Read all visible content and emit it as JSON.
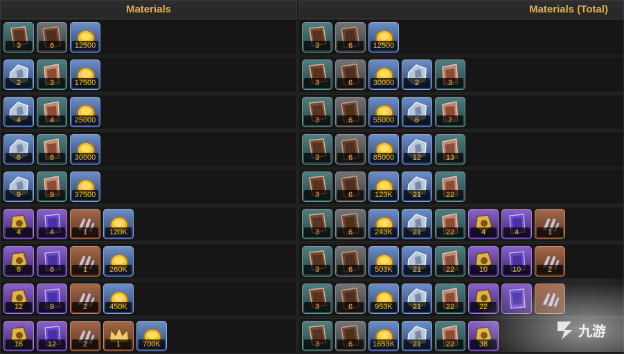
{
  "headers": {
    "left": "Materials",
    "right": "Materials (Total)"
  },
  "left_rows": [
    [
      {
        "icon": "leather-scroll-icon",
        "tier": "teal",
        "qty": "3"
      },
      {
        "icon": "leather-tome-icon",
        "tier": "gray",
        "qty": "6"
      },
      {
        "icon": "gold-coin-icon",
        "tier": "blue",
        "qty": "12500"
      }
    ],
    [
      {
        "icon": "ore-chunk-icon",
        "tier": "blue",
        "qty": "2"
      },
      {
        "icon": "cloth-roll-icon",
        "tier": "teal",
        "qty": "3"
      },
      {
        "icon": "gold-coin-icon",
        "tier": "blue",
        "qty": "17500"
      }
    ],
    [
      {
        "icon": "ore-chunk-icon",
        "tier": "blue",
        "qty": "4"
      },
      {
        "icon": "cloth-roll-icon",
        "tier": "teal",
        "qty": "4"
      },
      {
        "icon": "gold-coin-icon",
        "tier": "blue",
        "qty": "25000"
      }
    ],
    [
      {
        "icon": "ore-chunk-icon",
        "tier": "blue",
        "qty": "6"
      },
      {
        "icon": "cloth-roll-icon",
        "tier": "teal",
        "qty": "6"
      },
      {
        "icon": "gold-coin-icon",
        "tier": "blue",
        "qty": "30000"
      }
    ],
    [
      {
        "icon": "ore-chunk-icon",
        "tier": "blue",
        "qty": "9"
      },
      {
        "icon": "cloth-roll-icon",
        "tier": "teal",
        "qty": "9"
      },
      {
        "icon": "gold-coin-icon",
        "tier": "blue",
        "qty": "37500"
      }
    ],
    [
      {
        "icon": "gold-relic-icon",
        "tier": "purple",
        "qty": "4"
      },
      {
        "icon": "violet-scroll-icon",
        "tier": "purple",
        "qty": "4"
      },
      {
        "icon": "claw-gauntlet-icon",
        "tier": "orange",
        "qty": "1"
      },
      {
        "icon": "gold-coin-icon",
        "tier": "blue",
        "qty": "120K"
      }
    ],
    [
      {
        "icon": "gold-relic-icon",
        "tier": "purple",
        "qty": "6"
      },
      {
        "icon": "violet-scroll-icon",
        "tier": "purple",
        "qty": "6"
      },
      {
        "icon": "claw-gauntlet-icon",
        "tier": "orange",
        "qty": "1"
      },
      {
        "icon": "gold-coin-icon",
        "tier": "blue",
        "qty": "260K"
      }
    ],
    [
      {
        "icon": "gold-relic-icon",
        "tier": "purple",
        "qty": "12"
      },
      {
        "icon": "violet-scroll-icon",
        "tier": "purple",
        "qty": "9"
      },
      {
        "icon": "claw-gauntlet-icon",
        "tier": "orange",
        "qty": "2"
      },
      {
        "icon": "gold-coin-icon",
        "tier": "blue",
        "qty": "450K"
      }
    ],
    [
      {
        "icon": "gold-relic-icon",
        "tier": "purple",
        "qty": "16"
      },
      {
        "icon": "violet-scroll-icon",
        "tier": "purple",
        "qty": "12"
      },
      {
        "icon": "claw-gauntlet-icon",
        "tier": "orange",
        "qty": "2"
      },
      {
        "icon": "crown-icon",
        "tier": "orange",
        "qty": "1"
      },
      {
        "icon": "gold-coin-icon",
        "tier": "blue",
        "qty": "700K"
      }
    ]
  ],
  "right_rows": [
    [
      {
        "icon": "leather-scroll-icon",
        "tier": "teal",
        "qty": "3"
      },
      {
        "icon": "leather-tome-icon",
        "tier": "gray",
        "qty": "6"
      },
      {
        "icon": "gold-coin-icon",
        "tier": "blue",
        "qty": "12500"
      }
    ],
    [
      {
        "icon": "leather-scroll-icon",
        "tier": "teal",
        "qty": "3"
      },
      {
        "icon": "leather-tome-icon",
        "tier": "gray",
        "qty": "6"
      },
      {
        "icon": "gold-coin-icon",
        "tier": "blue",
        "qty": "30000"
      },
      {
        "icon": "ore-chunk-icon",
        "tier": "blue",
        "qty": "2"
      },
      {
        "icon": "cloth-roll-icon",
        "tier": "teal",
        "qty": "3"
      }
    ],
    [
      {
        "icon": "leather-scroll-icon",
        "tier": "teal",
        "qty": "3"
      },
      {
        "icon": "leather-tome-icon",
        "tier": "gray",
        "qty": "6"
      },
      {
        "icon": "gold-coin-icon",
        "tier": "blue",
        "qty": "55000"
      },
      {
        "icon": "ore-chunk-icon",
        "tier": "blue",
        "qty": "6"
      },
      {
        "icon": "cloth-roll-icon",
        "tier": "teal",
        "qty": "7"
      }
    ],
    [
      {
        "icon": "leather-scroll-icon",
        "tier": "teal",
        "qty": "3"
      },
      {
        "icon": "leather-tome-icon",
        "tier": "gray",
        "qty": "6"
      },
      {
        "icon": "gold-coin-icon",
        "tier": "blue",
        "qty": "85000"
      },
      {
        "icon": "ore-chunk-icon",
        "tier": "blue",
        "qty": "12"
      },
      {
        "icon": "cloth-roll-icon",
        "tier": "teal",
        "qty": "13"
      }
    ],
    [
      {
        "icon": "leather-scroll-icon",
        "tier": "teal",
        "qty": "3"
      },
      {
        "icon": "leather-tome-icon",
        "tier": "gray",
        "qty": "6"
      },
      {
        "icon": "gold-coin-icon",
        "tier": "blue",
        "qty": "123K"
      },
      {
        "icon": "ore-chunk-icon",
        "tier": "blue",
        "qty": "21"
      },
      {
        "icon": "cloth-roll-icon",
        "tier": "teal",
        "qty": "22"
      }
    ],
    [
      {
        "icon": "leather-scroll-icon",
        "tier": "teal",
        "qty": "3"
      },
      {
        "icon": "leather-tome-icon",
        "tier": "gray",
        "qty": "6"
      },
      {
        "icon": "gold-coin-icon",
        "tier": "blue",
        "qty": "243K"
      },
      {
        "icon": "ore-chunk-icon",
        "tier": "blue",
        "qty": "21"
      },
      {
        "icon": "cloth-roll-icon",
        "tier": "teal",
        "qty": "22"
      },
      {
        "icon": "gold-relic-icon",
        "tier": "purple",
        "qty": "4"
      },
      {
        "icon": "violet-scroll-icon",
        "tier": "purple",
        "qty": "4"
      },
      {
        "icon": "claw-gauntlet-icon",
        "tier": "orange",
        "qty": "1"
      }
    ],
    [
      {
        "icon": "leather-scroll-icon",
        "tier": "teal",
        "qty": "3"
      },
      {
        "icon": "leather-tome-icon",
        "tier": "gray",
        "qty": "6"
      },
      {
        "icon": "gold-coin-icon",
        "tier": "blue",
        "qty": "503K"
      },
      {
        "icon": "ore-chunk-icon",
        "tier": "blue",
        "qty": "21"
      },
      {
        "icon": "cloth-roll-icon",
        "tier": "teal",
        "qty": "22"
      },
      {
        "icon": "gold-relic-icon",
        "tier": "purple",
        "qty": "10"
      },
      {
        "icon": "violet-scroll-icon",
        "tier": "purple",
        "qty": "10"
      },
      {
        "icon": "claw-gauntlet-icon",
        "tier": "orange",
        "qty": "2"
      }
    ],
    [
      {
        "icon": "leather-scroll-icon",
        "tier": "teal",
        "qty": "3"
      },
      {
        "icon": "leather-tome-icon",
        "tier": "gray",
        "qty": "6"
      },
      {
        "icon": "gold-coin-icon",
        "tier": "blue",
        "qty": "953K"
      },
      {
        "icon": "ore-chunk-icon",
        "tier": "blue",
        "qty": "21"
      },
      {
        "icon": "cloth-roll-icon",
        "tier": "teal",
        "qty": "22"
      },
      {
        "icon": "gold-relic-icon",
        "tier": "purple",
        "qty": "22"
      },
      {
        "icon": "violet-scroll-icon",
        "tier": "purple",
        "qty": ""
      },
      {
        "icon": "claw-gauntlet-icon",
        "tier": "orange",
        "qty": ""
      }
    ],
    [
      {
        "icon": "leather-scroll-icon",
        "tier": "teal",
        "qty": "3"
      },
      {
        "icon": "leather-tome-icon",
        "tier": "gray",
        "qty": "6"
      },
      {
        "icon": "gold-coin-icon",
        "tier": "blue",
        "qty": "1653K"
      },
      {
        "icon": "ore-chunk-icon",
        "tier": "blue",
        "qty": "21"
      },
      {
        "icon": "cloth-roll-icon",
        "tier": "teal",
        "qty": "22"
      },
      {
        "icon": "gold-relic-icon",
        "tier": "purple",
        "qty": "38"
      }
    ]
  ],
  "watermark": {
    "icon": "jiuyou-logo-icon",
    "text": "九游"
  }
}
